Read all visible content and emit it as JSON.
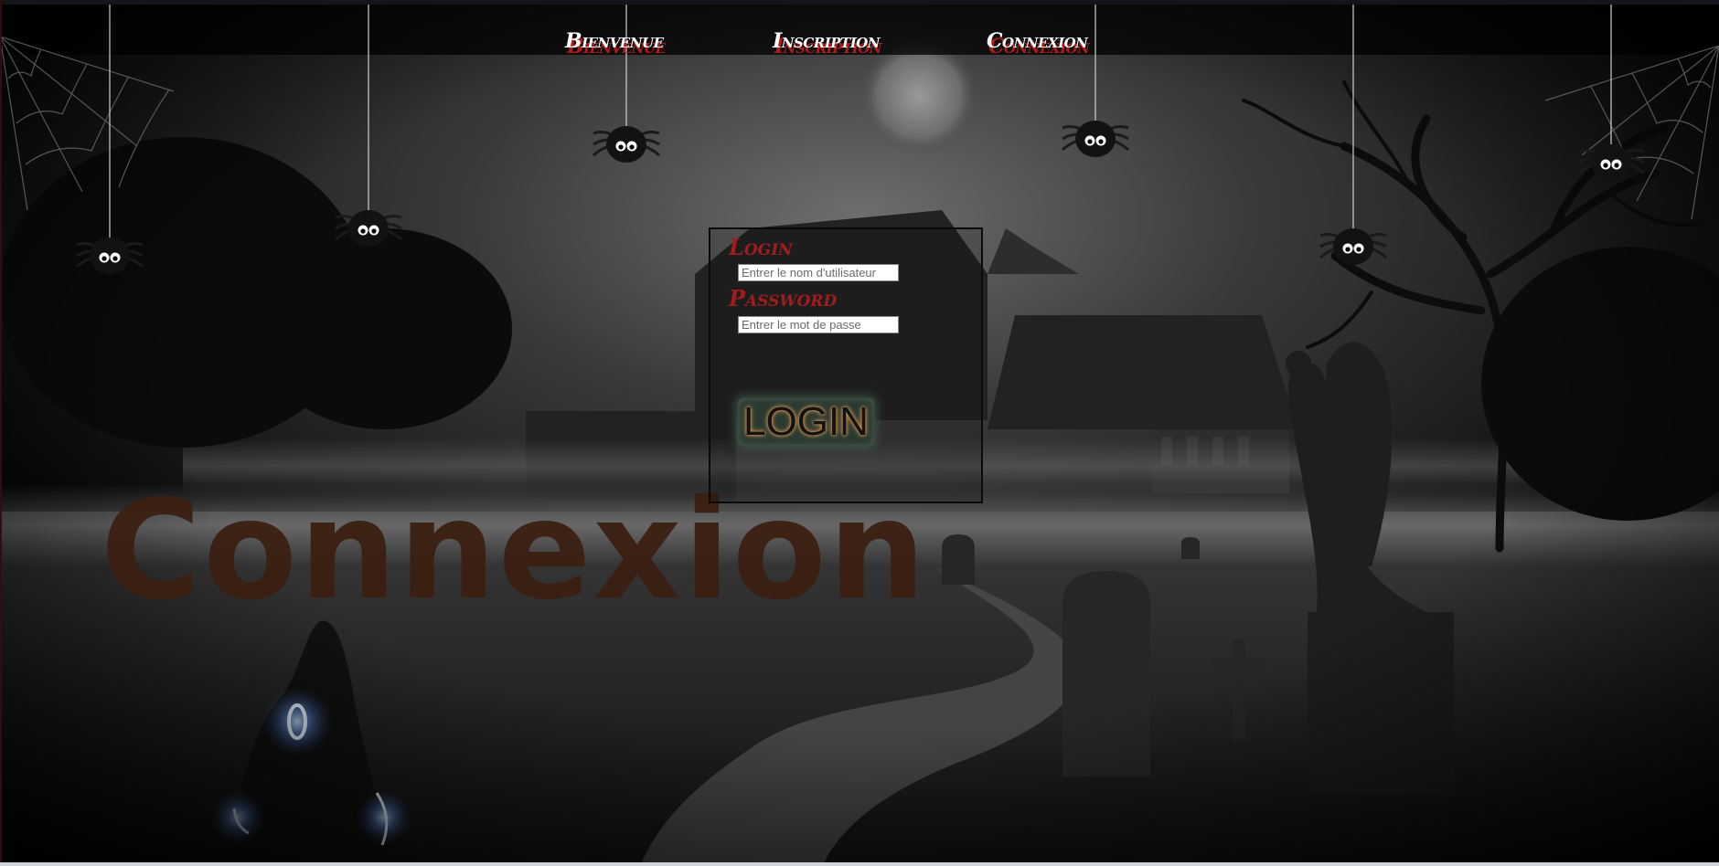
{
  "nav": {
    "items": [
      {
        "label": "Bienvenue"
      },
      {
        "label": "Inscription"
      },
      {
        "label": "Connexion"
      }
    ]
  },
  "page_title": "Connexion",
  "login_form": {
    "login_label": "Login",
    "username_placeholder": "Entrer le nom d'utilisateur",
    "password_label": "Password",
    "password_placeholder": "Entrer le mot de passe",
    "submit_label": "LOGIN"
  },
  "colors": {
    "nav_text": "#ffffff",
    "nav_shadow": "#b31a1a",
    "label_red": "#a31c1c",
    "watermark_brown": "#3b2012",
    "background": "#000000"
  },
  "icons": [
    "spider-icon",
    "cobweb-icon"
  ]
}
